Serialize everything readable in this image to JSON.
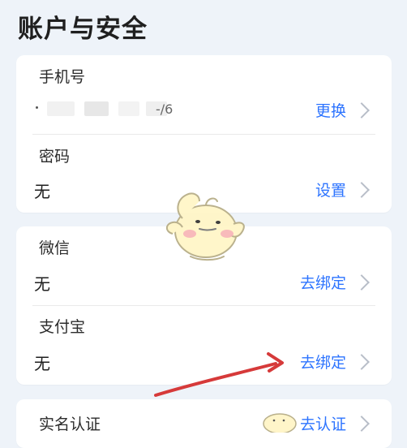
{
  "page": {
    "title": "账户与安全"
  },
  "sections": {
    "phone": {
      "label": "手机号",
      "value_prefix": ".",
      "value_suffix": "-/6",
      "action": "更换"
    },
    "password": {
      "label": "密码",
      "value": "无",
      "action": "设置"
    },
    "wechat": {
      "label": "微信",
      "value": "无",
      "action": "去绑定"
    },
    "alipay": {
      "label": "支付宝",
      "value": "无",
      "action": "去绑定"
    },
    "realname": {
      "label": "实名认证",
      "action": "去认证"
    }
  },
  "colors": {
    "background": "#eef3f9",
    "card": "#ffffff",
    "accent": "#2d74ff",
    "chevron": "#b8bec8",
    "annotation_arrow": "#d63a3a"
  },
  "icons": {
    "chevron": "chevron-right-icon",
    "mascot": "chick-mascot-icon",
    "annotation": "red-arrow-icon"
  }
}
